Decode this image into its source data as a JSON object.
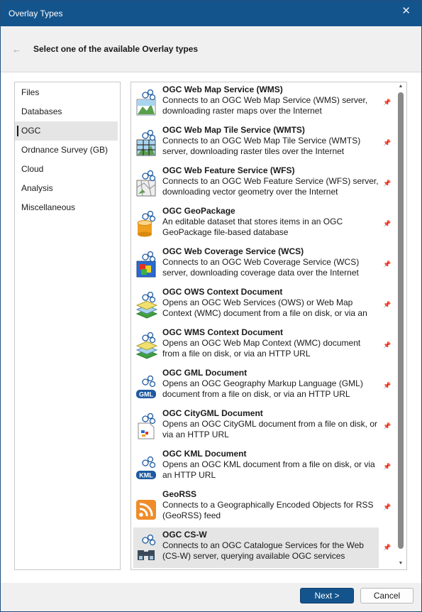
{
  "window": {
    "title": "Overlay Types"
  },
  "header": {
    "heading": "Select one of the available Overlay types"
  },
  "categories": [
    {
      "label": "Files"
    },
    {
      "label": "Databases"
    },
    {
      "label": "OGC",
      "selected": true
    },
    {
      "label": "Ordnance Survey (GB)"
    },
    {
      "label": "Cloud"
    },
    {
      "label": "Analysis"
    },
    {
      "label": "Miscellaneous"
    }
  ],
  "overlays": [
    {
      "name": "OGC Web Map Service (WMS)",
      "desc": "Connects to an OGC Web Map Service (WMS) server, downloading raster maps over the Internet",
      "icon": "wms-icon"
    },
    {
      "name": "OGC Web Map Tile Service (WMTS)",
      "desc": "Connects to an OGC Web Map Tile Service (WMTS) server, downloading raster tiles over the Internet",
      "icon": "wmts-icon"
    },
    {
      "name": "OGC Web Feature Service (WFS)",
      "desc": "Connects to an OGC Web Feature Service (WFS) server, downloading vector geometry over the Internet",
      "icon": "wfs-icon"
    },
    {
      "name": "OGC GeoPackage",
      "desc": "An editable dataset that stores items in an OGC GeoPackage file-based database",
      "icon": "geopackage-icon"
    },
    {
      "name": "OGC Web Coverage Service (WCS)",
      "desc": "Connects to an OGC Web Coverage Service (WCS) server, downloading coverage data over the Internet",
      "icon": "wcs-icon"
    },
    {
      "name": "OGC OWS Context Document",
      "desc": "Opens an OGC Web Services (OWS) or Web Map Context (WMC) document from a file on disk, or via an",
      "icon": "ows-context-icon"
    },
    {
      "name": "OGC WMS Context Document",
      "desc": "Opens an OGC Web Map Context (WMC) document from a file on disk, or via an HTTP URL",
      "icon": "wms-context-icon"
    },
    {
      "name": "OGC GML Document",
      "desc": "Opens an OGC Geography Markup Language (GML) document from a file on disk, or via an HTTP URL",
      "icon": "gml-icon"
    },
    {
      "name": "OGC CityGML Document",
      "desc": "Opens an OGC CityGML document from a file on disk, or via an HTTP URL",
      "icon": "citygml-icon"
    },
    {
      "name": "OGC KML Document",
      "desc": "Opens an OGC KML document from a file on disk, or via an HTTP URL",
      "icon": "kml-icon"
    },
    {
      "name": "GeoRSS",
      "desc": "Connects to a Geographically Encoded Objects for RSS (GeoRSS) feed",
      "icon": "georss-icon"
    },
    {
      "name": "OGC CS-W",
      "desc": "Connects to an OGC Catalogue Services for the Web (CS-W) server, querying available OGC services",
      "icon": "csw-icon",
      "selected": true
    }
  ],
  "icon_badges": {
    "gml": "GML",
    "kml": "KML"
  },
  "footer": {
    "next_label": "Next >",
    "cancel_label": "Cancel"
  },
  "colors": {
    "titlebar": "#14548c",
    "primary_button": "#14548c",
    "badge": "#1e5aa0",
    "georss": "#f08c28"
  }
}
